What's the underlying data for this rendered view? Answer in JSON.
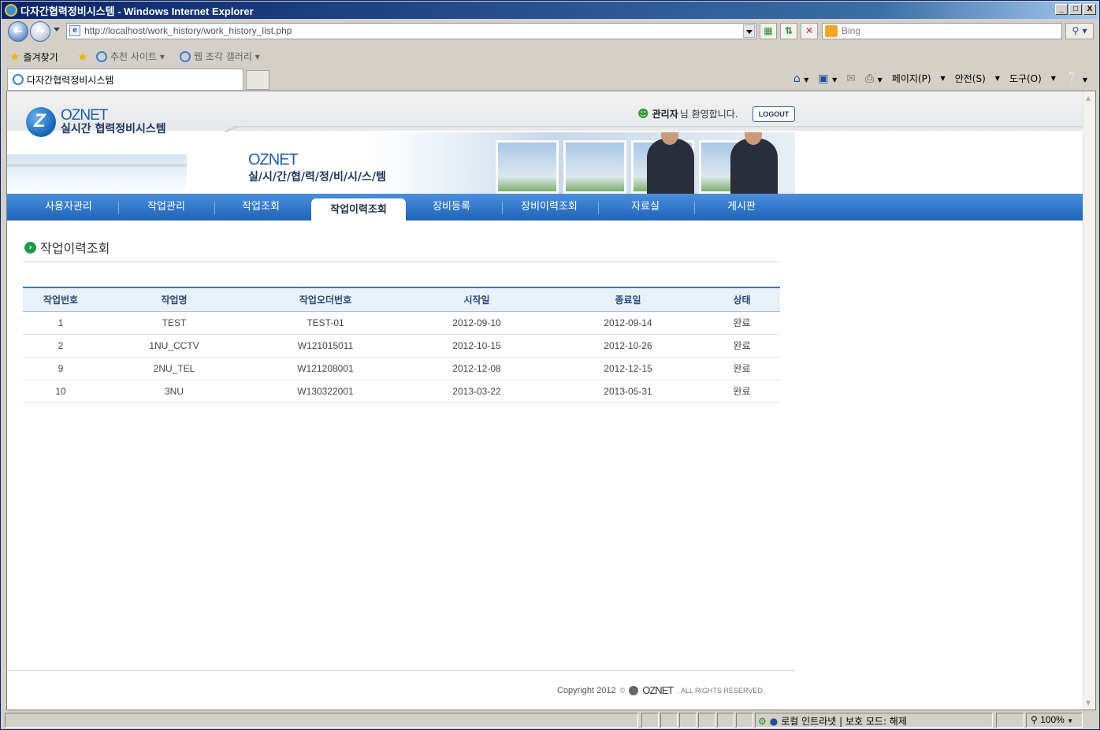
{
  "window": {
    "title": "다자간협력정비시스템 - Windows Internet Explorer",
    "controls": [
      "_",
      "□",
      "X"
    ]
  },
  "browser": {
    "url": "http://localhost/work_history/work_history_list.php",
    "search_placeholder": "Bing",
    "favorites_label": "즐겨찾기",
    "fav_items": [
      "추천 사이트 ▾",
      "웹 조각 갤러리 ▾"
    ],
    "tab_title": "다자간협력정비시스템",
    "command_menus": [
      "페이지(P)",
      "안전(S)",
      "도구(O)"
    ],
    "status_zone": "로컬 인트라넷 | 보호 모드: 해제",
    "zoom": "100%"
  },
  "site": {
    "brand": "OZNET",
    "brand_sub": "실시간 협력정비시스템",
    "banner_brand": "OZNET",
    "banner_sub": "실/시/간/협/력/정/비/시/스/템",
    "user_name": "관리자",
    "user_greeting": "님 환영합니다.",
    "logout_label": "LOGOUT",
    "menu": [
      "사용자관리",
      "작업관리",
      "작업조회",
      "작업이력조회",
      "장비등록",
      "장비이력조회",
      "자료실",
      "게시판"
    ],
    "active_menu": "작업이력조회"
  },
  "page": {
    "title": "작업이력조회",
    "table": {
      "columns": [
        "작업번호",
        "작업명",
        "작업오더번호",
        "시작일",
        "종료일",
        "상태"
      ],
      "rows": [
        [
          "1",
          "TEST",
          "TEST-01",
          "2012-09-10",
          "2012-09-14",
          "완료"
        ],
        [
          "2",
          "1NU_CCTV",
          "W121015011",
          "2012-10-15",
          "2012-10-26",
          "완료"
        ],
        [
          "9",
          "2NU_TEL",
          "W121208001",
          "2012-12-08",
          "2012-12-15",
          "완료"
        ],
        [
          "10",
          "3NU",
          "W130322001",
          "2013-03-22",
          "2013-05-31",
          "완료"
        ]
      ]
    }
  },
  "footer": {
    "copyright": "Copyright 2012",
    "copy_symbol": "©",
    "brand": "OZNET",
    "rights": ". ALL RIGHTS RESERVED."
  },
  "colors": {
    "menu_blue": "#1f62b8",
    "brand_blue": "#1e5ea8",
    "title_bar": "#0a246a"
  }
}
